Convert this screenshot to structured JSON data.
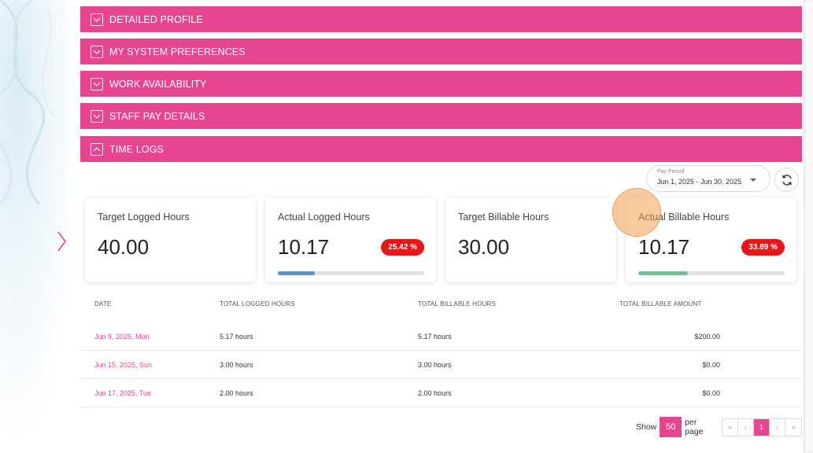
{
  "accordion": [
    {
      "label": "DETAILED PROFILE",
      "expanded": false
    },
    {
      "label": "MY SYSTEM PREFERENCES",
      "expanded": false
    },
    {
      "label": "WORK AVAILABILITY",
      "expanded": false
    },
    {
      "label": "STAFF PAY DETAILS",
      "expanded": false
    },
    {
      "label": "TIME LOGS",
      "expanded": true
    }
  ],
  "time_logs": {
    "pay_period": {
      "label": "Pay Period",
      "value": "Jun 1, 2025 - Jun 30, 2025"
    },
    "cards": [
      {
        "title": "Target Logged Hours",
        "value": "40.00"
      },
      {
        "title": "Actual Logged Hours",
        "value": "10.17",
        "badge": "25.42 %",
        "progress": 0.2542,
        "bar_color": "#5b93c9"
      },
      {
        "title": "Target Billable Hours",
        "value": "30.00"
      },
      {
        "title": "Actual Billable Hours",
        "value": "10.17",
        "badge": "33.89 %",
        "progress": 0.3389,
        "bar_color": "#6cc38e"
      }
    ],
    "table": {
      "headers": [
        "DATE",
        "TOTAL LOGGED HOURS",
        "TOTAL BILLABLE HOURS",
        "TOTAL BILLABLE AMOUNT"
      ],
      "rows": [
        {
          "date": "Jun 9, 2025, Mon",
          "logged": "5.17 hours",
          "billable": "5.17 hours",
          "amount": "$200.00"
        },
        {
          "date": "Jun 15, 2025, Sun",
          "logged": "3.00 hours",
          "billable": "3.00 hours",
          "amount": "$0.00"
        },
        {
          "date": "Jun 17, 2025, Tue",
          "logged": "2.00 hours",
          "billable": "2.00 hours",
          "amount": "$0.00"
        }
      ]
    },
    "pagination": {
      "show_label": "Show",
      "page_size": "50",
      "per_page_label": "per page",
      "first": "«",
      "prev": "‹",
      "current": "1",
      "next": "›",
      "last": "»"
    }
  },
  "colors": {
    "accent": "#e6458f",
    "badge": "#e8151b"
  }
}
